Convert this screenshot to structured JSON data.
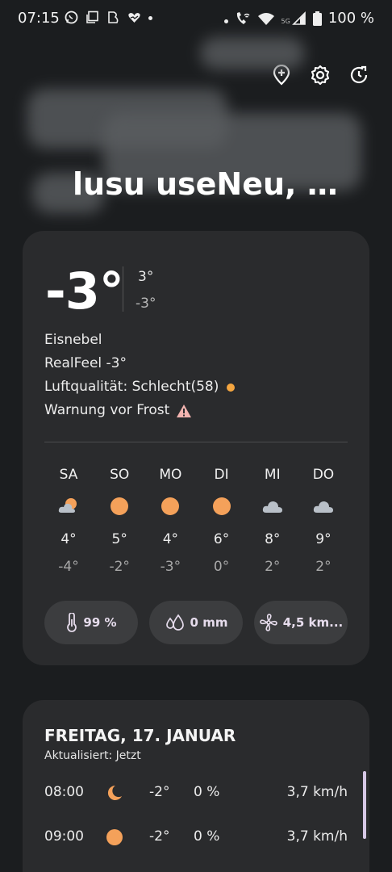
{
  "status_bar": {
    "time": "07:15",
    "battery": "100 %",
    "network_label": "5G",
    "left_icons": [
      "whatsapp-icon",
      "copy-icon",
      "app-icon",
      "heart-icon",
      "dot"
    ],
    "right_icons": [
      "dot",
      "wifi-call-icon",
      "wifi-icon",
      "signal-icon",
      "battery-icon"
    ]
  },
  "header": {
    "actions": [
      "add-location-icon",
      "settings-icon",
      "refresh-icon"
    ],
    "city": "lusu useNeu, N..."
  },
  "current": {
    "temperature": "-3°",
    "high": "3°",
    "low": "-3°",
    "condition": "Eisnebel",
    "realfeel": "RealFeel -3°",
    "air_quality": "Luftqualität: Schlecht(58)",
    "air_quality_color": "#f5a640",
    "warning": "Warnung vor Frost"
  },
  "forecast": [
    {
      "day": "SA",
      "icon": "partly-cloudy-icon",
      "high": "4°",
      "low": "-4°"
    },
    {
      "day": "SO",
      "icon": "sun-icon",
      "high": "5°",
      "low": "-2°"
    },
    {
      "day": "MO",
      "icon": "sun-icon",
      "high": "4°",
      "low": "-3°"
    },
    {
      "day": "DI",
      "icon": "sun-icon",
      "high": "6°",
      "low": "0°"
    },
    {
      "day": "MI",
      "icon": "cloud-icon",
      "high": "8°",
      "low": "2°"
    },
    {
      "day": "DO",
      "icon": "cloud-icon",
      "high": "9°",
      "low": "2°"
    }
  ],
  "chips": {
    "humidity": "99 %",
    "precipitation": "0 mm",
    "wind": "4,5 km..."
  },
  "hourly": {
    "title": "FREITAG, 17. JANUAR",
    "updated": "Aktualisiert: Jetzt",
    "rows": [
      {
        "time": "08:00",
        "icon": "moon-icon",
        "temp": "-2°",
        "precip": "0 %",
        "wind": "3,7 km/h"
      },
      {
        "time": "09:00",
        "icon": "sun-icon",
        "temp": "-2°",
        "precip": "0 %",
        "wind": "3,7 km/h"
      }
    ]
  },
  "colors": {
    "background": "#1b1d1f",
    "card": "#2a2b2d",
    "chip": "#3c3d3f",
    "sun": "#f4a15a",
    "accent_scroll": "#d7c8e6"
  }
}
